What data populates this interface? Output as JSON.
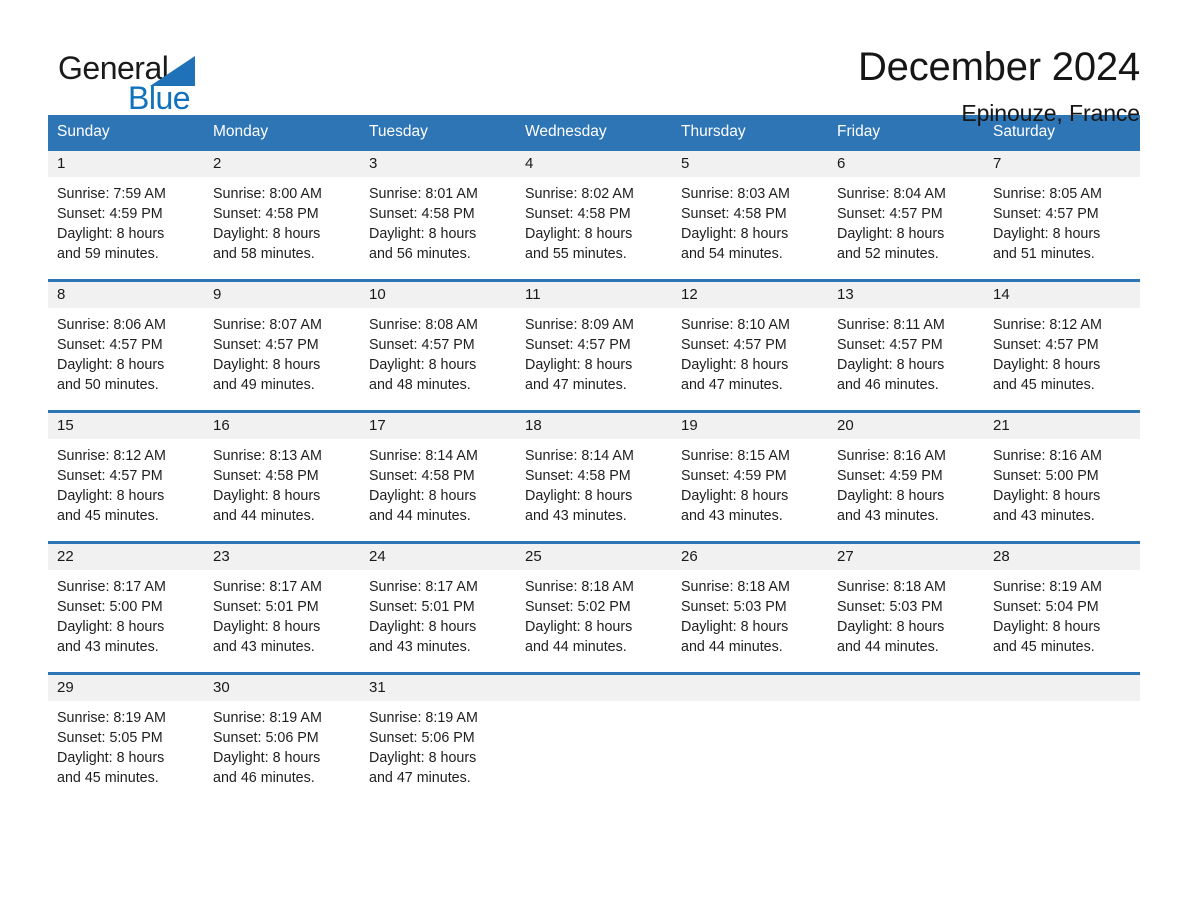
{
  "brand": {
    "name_part1": "General",
    "name_part2": "Blue",
    "color_primary": "#2e75b6",
    "color_blue_text": "#1072bd"
  },
  "header": {
    "title": "December 2024",
    "location": "Epinouze, France"
  },
  "calendar": {
    "weekday_headers": [
      "Sunday",
      "Monday",
      "Tuesday",
      "Wednesday",
      "Thursday",
      "Friday",
      "Saturday"
    ],
    "weeks": [
      [
        {
          "day": "1",
          "sunrise": "Sunrise: 7:59 AM",
          "sunset": "Sunset: 4:59 PM",
          "daylight_line1": "Daylight: 8 hours",
          "daylight_line2": "and 59 minutes."
        },
        {
          "day": "2",
          "sunrise": "Sunrise: 8:00 AM",
          "sunset": "Sunset: 4:58 PM",
          "daylight_line1": "Daylight: 8 hours",
          "daylight_line2": "and 58 minutes."
        },
        {
          "day": "3",
          "sunrise": "Sunrise: 8:01 AM",
          "sunset": "Sunset: 4:58 PM",
          "daylight_line1": "Daylight: 8 hours",
          "daylight_line2": "and 56 minutes."
        },
        {
          "day": "4",
          "sunrise": "Sunrise: 8:02 AM",
          "sunset": "Sunset: 4:58 PM",
          "daylight_line1": "Daylight: 8 hours",
          "daylight_line2": "and 55 minutes."
        },
        {
          "day": "5",
          "sunrise": "Sunrise: 8:03 AM",
          "sunset": "Sunset: 4:58 PM",
          "daylight_line1": "Daylight: 8 hours",
          "daylight_line2": "and 54 minutes."
        },
        {
          "day": "6",
          "sunrise": "Sunrise: 8:04 AM",
          "sunset": "Sunset: 4:57 PM",
          "daylight_line1": "Daylight: 8 hours",
          "daylight_line2": "and 52 minutes."
        },
        {
          "day": "7",
          "sunrise": "Sunrise: 8:05 AM",
          "sunset": "Sunset: 4:57 PM",
          "daylight_line1": "Daylight: 8 hours",
          "daylight_line2": "and 51 minutes."
        }
      ],
      [
        {
          "day": "8",
          "sunrise": "Sunrise: 8:06 AM",
          "sunset": "Sunset: 4:57 PM",
          "daylight_line1": "Daylight: 8 hours",
          "daylight_line2": "and 50 minutes."
        },
        {
          "day": "9",
          "sunrise": "Sunrise: 8:07 AM",
          "sunset": "Sunset: 4:57 PM",
          "daylight_line1": "Daylight: 8 hours",
          "daylight_line2": "and 49 minutes."
        },
        {
          "day": "10",
          "sunrise": "Sunrise: 8:08 AM",
          "sunset": "Sunset: 4:57 PM",
          "daylight_line1": "Daylight: 8 hours",
          "daylight_line2": "and 48 minutes."
        },
        {
          "day": "11",
          "sunrise": "Sunrise: 8:09 AM",
          "sunset": "Sunset: 4:57 PM",
          "daylight_line1": "Daylight: 8 hours",
          "daylight_line2": "and 47 minutes."
        },
        {
          "day": "12",
          "sunrise": "Sunrise: 8:10 AM",
          "sunset": "Sunset: 4:57 PM",
          "daylight_line1": "Daylight: 8 hours",
          "daylight_line2": "and 47 minutes."
        },
        {
          "day": "13",
          "sunrise": "Sunrise: 8:11 AM",
          "sunset": "Sunset: 4:57 PM",
          "daylight_line1": "Daylight: 8 hours",
          "daylight_line2": "and 46 minutes."
        },
        {
          "day": "14",
          "sunrise": "Sunrise: 8:12 AM",
          "sunset": "Sunset: 4:57 PM",
          "daylight_line1": "Daylight: 8 hours",
          "daylight_line2": "and 45 minutes."
        }
      ],
      [
        {
          "day": "15",
          "sunrise": "Sunrise: 8:12 AM",
          "sunset": "Sunset: 4:57 PM",
          "daylight_line1": "Daylight: 8 hours",
          "daylight_line2": "and 45 minutes."
        },
        {
          "day": "16",
          "sunrise": "Sunrise: 8:13 AM",
          "sunset": "Sunset: 4:58 PM",
          "daylight_line1": "Daylight: 8 hours",
          "daylight_line2": "and 44 minutes."
        },
        {
          "day": "17",
          "sunrise": "Sunrise: 8:14 AM",
          "sunset": "Sunset: 4:58 PM",
          "daylight_line1": "Daylight: 8 hours",
          "daylight_line2": "and 44 minutes."
        },
        {
          "day": "18",
          "sunrise": "Sunrise: 8:14 AM",
          "sunset": "Sunset: 4:58 PM",
          "daylight_line1": "Daylight: 8 hours",
          "daylight_line2": "and 43 minutes."
        },
        {
          "day": "19",
          "sunrise": "Sunrise: 8:15 AM",
          "sunset": "Sunset: 4:59 PM",
          "daylight_line1": "Daylight: 8 hours",
          "daylight_line2": "and 43 minutes."
        },
        {
          "day": "20",
          "sunrise": "Sunrise: 8:16 AM",
          "sunset": "Sunset: 4:59 PM",
          "daylight_line1": "Daylight: 8 hours",
          "daylight_line2": "and 43 minutes."
        },
        {
          "day": "21",
          "sunrise": "Sunrise: 8:16 AM",
          "sunset": "Sunset: 5:00 PM",
          "daylight_line1": "Daylight: 8 hours",
          "daylight_line2": "and 43 minutes."
        }
      ],
      [
        {
          "day": "22",
          "sunrise": "Sunrise: 8:17 AM",
          "sunset": "Sunset: 5:00 PM",
          "daylight_line1": "Daylight: 8 hours",
          "daylight_line2": "and 43 minutes."
        },
        {
          "day": "23",
          "sunrise": "Sunrise: 8:17 AM",
          "sunset": "Sunset: 5:01 PM",
          "daylight_line1": "Daylight: 8 hours",
          "daylight_line2": "and 43 minutes."
        },
        {
          "day": "24",
          "sunrise": "Sunrise: 8:17 AM",
          "sunset": "Sunset: 5:01 PM",
          "daylight_line1": "Daylight: 8 hours",
          "daylight_line2": "and 43 minutes."
        },
        {
          "day": "25",
          "sunrise": "Sunrise: 8:18 AM",
          "sunset": "Sunset: 5:02 PM",
          "daylight_line1": "Daylight: 8 hours",
          "daylight_line2": "and 44 minutes."
        },
        {
          "day": "26",
          "sunrise": "Sunrise: 8:18 AM",
          "sunset": "Sunset: 5:03 PM",
          "daylight_line1": "Daylight: 8 hours",
          "daylight_line2": "and 44 minutes."
        },
        {
          "day": "27",
          "sunrise": "Sunrise: 8:18 AM",
          "sunset": "Sunset: 5:03 PM",
          "daylight_line1": "Daylight: 8 hours",
          "daylight_line2": "and 44 minutes."
        },
        {
          "day": "28",
          "sunrise": "Sunrise: 8:19 AM",
          "sunset": "Sunset: 5:04 PM",
          "daylight_line1": "Daylight: 8 hours",
          "daylight_line2": "and 45 minutes."
        }
      ],
      [
        {
          "day": "29",
          "sunrise": "Sunrise: 8:19 AM",
          "sunset": "Sunset: 5:05 PM",
          "daylight_line1": "Daylight: 8 hours",
          "daylight_line2": "and 45 minutes."
        },
        {
          "day": "30",
          "sunrise": "Sunrise: 8:19 AM",
          "sunset": "Sunset: 5:06 PM",
          "daylight_line1": "Daylight: 8 hours",
          "daylight_line2": "and 46 minutes."
        },
        {
          "day": "31",
          "sunrise": "Sunrise: 8:19 AM",
          "sunset": "Sunset: 5:06 PM",
          "daylight_line1": "Daylight: 8 hours",
          "daylight_line2": "and 47 minutes."
        },
        {
          "day": "",
          "sunrise": "",
          "sunset": "",
          "daylight_line1": "",
          "daylight_line2": ""
        },
        {
          "day": "",
          "sunrise": "",
          "sunset": "",
          "daylight_line1": "",
          "daylight_line2": ""
        },
        {
          "day": "",
          "sunrise": "",
          "sunset": "",
          "daylight_line1": "",
          "daylight_line2": ""
        },
        {
          "day": "",
          "sunrise": "",
          "sunset": "",
          "daylight_line1": "",
          "daylight_line2": ""
        }
      ]
    ]
  }
}
